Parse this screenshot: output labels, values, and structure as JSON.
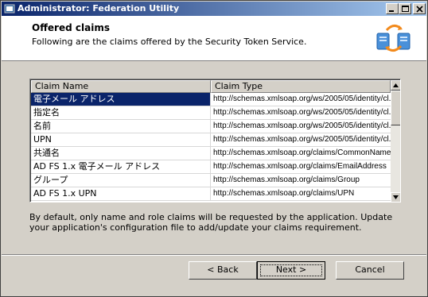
{
  "window": {
    "title": "Administrator: Federation Utility"
  },
  "header": {
    "title": "Offered claims",
    "subtitle": "Following are the claims offered by the Security Token Service."
  },
  "table": {
    "columns": [
      "Claim Name",
      "Claim Type"
    ],
    "rows": [
      {
        "name": "電子メール アドレス",
        "type": "http://schemas.xmlsoap.org/ws/2005/05/identity/cl...",
        "selected": true
      },
      {
        "name": "指定名",
        "type": "http://schemas.xmlsoap.org/ws/2005/05/identity/cl..."
      },
      {
        "name": "名前",
        "type": "http://schemas.xmlsoap.org/ws/2005/05/identity/cl..."
      },
      {
        "name": "UPN",
        "type": "http://schemas.xmlsoap.org/ws/2005/05/identity/cl..."
      },
      {
        "name": "共通名",
        "type": "http://schemas.xmlsoap.org/claims/CommonName"
      },
      {
        "name": "AD FS 1.x 電子メール アドレス",
        "type": "http://schemas.xmlsoap.org/claims/EmailAddress"
      },
      {
        "name": "グループ",
        "type": "http://schemas.xmlsoap.org/claims/Group"
      },
      {
        "name": "AD FS 1.x UPN",
        "type": "http://schemas.xmlsoap.org/claims/UPN"
      }
    ]
  },
  "info": {
    "text": "By default, only name and role claims will be requested by the application. Update your application's configuration file to add/update your claims requirement."
  },
  "buttons": {
    "back": "< Back",
    "next": "Next >",
    "cancel": "Cancel"
  },
  "colors": {
    "selection": "#0a246a",
    "title_gradient_start": "#0a246a",
    "title_gradient_end": "#a6caf0",
    "face": "#d4d0c8"
  },
  "icons": [
    "app-icon",
    "minimize-icon",
    "maximize-icon",
    "close-icon",
    "federation-icon",
    "scroll-up-icon",
    "scroll-down-icon"
  ]
}
